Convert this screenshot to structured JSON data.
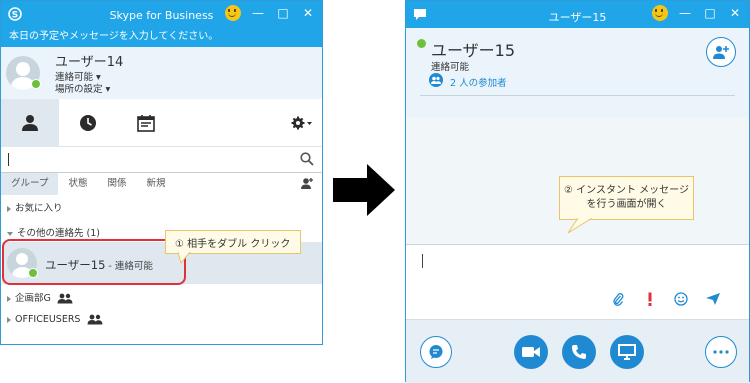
{
  "left_window": {
    "title": "Skype for Business",
    "mood_message": "本日の予定やメッセージを入力してください。",
    "me": {
      "name": "ユーザー14",
      "presence": "連絡可能 ▾",
      "location": "場所の設定 ▾"
    },
    "search_placeholder": "",
    "filters": [
      "グループ",
      "状態",
      "関係",
      "新規"
    ],
    "groups": {
      "favorites": "お気に入り",
      "other_contacts": "その他の連絡先 (1)",
      "planning": "企画部G",
      "office_users": "OFFICEUSERS"
    },
    "contact": {
      "name": "ユーザー15",
      "status": " - 連絡可能"
    },
    "callout_1": "① 相手をダブル クリック"
  },
  "right_window": {
    "title": "ユーザー15",
    "contact_name": "ユーザー15",
    "contact_status": "連絡可能",
    "participants": "2 人の参加者",
    "callout_2_line1": "② インスタント メッセージ",
    "callout_2_line2": "を行う画面が開く"
  },
  "colors": {
    "brand_blue": "#1fa5e8",
    "presence_green": "#6fbf3e",
    "highlight_red": "#e0303a",
    "urgent_red": "#e0303a"
  }
}
